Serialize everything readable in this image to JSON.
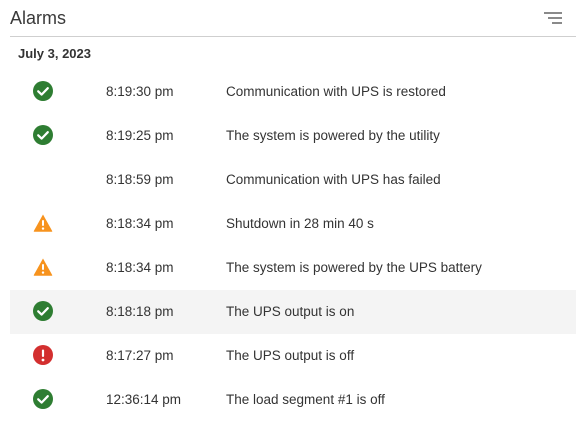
{
  "header": {
    "title": "Alarms"
  },
  "group": {
    "date": "July 3, 2023"
  },
  "colors": {
    "ok": "#2e7d32",
    "warning": "#f7931e",
    "error": "#d32f2f",
    "highlight_row": "#f4f4f4"
  },
  "alarms": [
    {
      "status": "ok",
      "icon": "check-circle-icon",
      "time": "8:19:30 pm",
      "message": "Communication with UPS is restored"
    },
    {
      "status": "ok",
      "icon": "check-circle-icon",
      "time": "8:19:25 pm",
      "message": "The system is powered by the utility"
    },
    {
      "status": "none",
      "icon": "",
      "time": "8:18:59 pm",
      "message": "Communication with UPS has failed"
    },
    {
      "status": "warning",
      "icon": "warning-triangle-icon",
      "time": "8:18:34 pm",
      "message": "Shutdown in 28 min 40 s"
    },
    {
      "status": "warning",
      "icon": "warning-triangle-icon",
      "time": "8:18:34 pm",
      "message": "The system is powered by the UPS battery"
    },
    {
      "status": "ok",
      "icon": "check-circle-icon",
      "time": "8:18:18 pm",
      "message": "The UPS output is on",
      "highlighted": true
    },
    {
      "status": "error",
      "icon": "error-circle-icon",
      "time": "8:17:27 pm",
      "message": "The UPS output is off"
    },
    {
      "status": "ok",
      "icon": "check-circle-icon",
      "time": "12:36:14 pm",
      "message": "The load segment #1 is off"
    }
  ]
}
